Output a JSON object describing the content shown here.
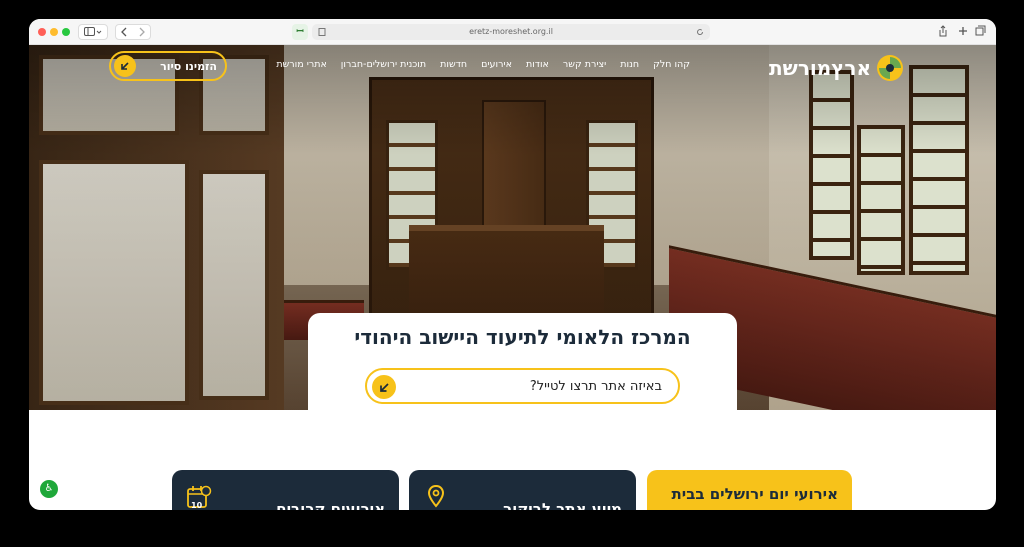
{
  "browser": {
    "url": "eretz-moreshet.org.il",
    "favicon_glyph": "ꟷ"
  },
  "brand": {
    "logo_text": "ארץמורשת",
    "colors": {
      "accent": "#f7c21a",
      "dark": "#1c2b3a",
      "green": "#6aa84f"
    }
  },
  "nav": {
    "items": [
      "אתרי מורשת",
      "תוכנית ירושלים-חברון",
      "חדשות",
      "אירועים",
      "אודות",
      "יצירת קשר",
      "חנות",
      "קהו חלק"
    ],
    "cta_label": "הזמינו סיור"
  },
  "hero": {
    "title": "המרכז הלאומי לתיעוד היישוב היהודי",
    "search_text": "באיזה אתר תרצו לטייל?"
  },
  "cards": [
    {
      "title": "אירועי יום ירושלים בבית",
      "icon": "none",
      "theme": "yellow"
    },
    {
      "title": "מיוע אתר לביקור",
      "icon": "location-pin-icon",
      "theme": "dark"
    },
    {
      "title": "אירועים קרובים",
      "icon": "calendar-icon",
      "theme": "dark",
      "icon_number": "10"
    }
  ]
}
